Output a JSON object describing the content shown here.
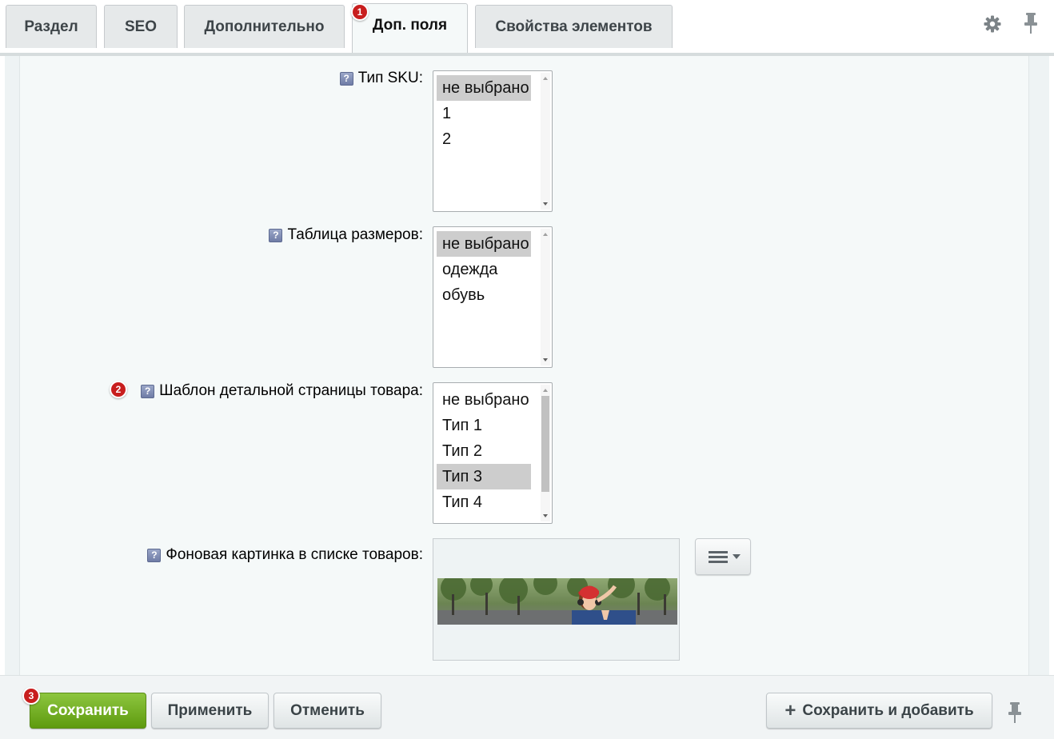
{
  "tabs": [
    {
      "label": "Раздел",
      "active": false
    },
    {
      "label": "SEO",
      "active": false
    },
    {
      "label": "Дополнительно",
      "active": false
    },
    {
      "label": "Доп. поля",
      "active": true
    },
    {
      "label": "Свойства элементов",
      "active": false
    }
  ],
  "badges": {
    "tab": "1",
    "field": "2",
    "save": "3"
  },
  "icons": {
    "settings": "gear-icon",
    "pin": "pin-icon",
    "help": "help-icon",
    "menu": "menu-icon",
    "plus": "plus-icon"
  },
  "help_glyph": "?",
  "fields": {
    "sku": {
      "label": "Тип SKU:",
      "options": [
        "не выбрано",
        "1",
        "2"
      ],
      "selected": "не выбрано"
    },
    "sizes": {
      "label": "Таблица размеров:",
      "options": [
        "не выбрано",
        "одежда",
        "обувь"
      ],
      "selected": "не выбрано"
    },
    "template": {
      "label": "Шаблон детальной страницы товара:",
      "options": [
        "не выбрано",
        "Тип 1",
        "Тип 2",
        "Тип 3",
        "Тип 4"
      ],
      "selected": "Тип 3"
    },
    "background": {
      "label": "Фоновая картинка в списке товаров:"
    }
  },
  "footer": {
    "save": "Сохранить",
    "apply": "Применить",
    "cancel": "Отменить",
    "save_add": "Сохранить и добавить"
  },
  "colors": {
    "accent_green": "#6aab1e",
    "badge_red": "#c81e1e",
    "selected_option": "#cdcdcd"
  }
}
